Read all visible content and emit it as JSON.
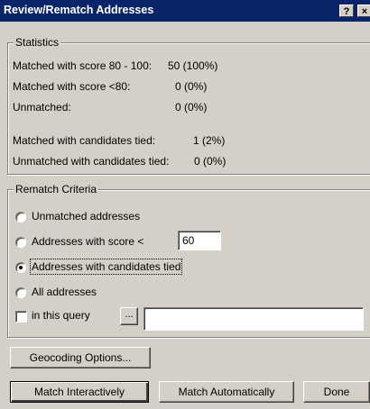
{
  "window": {
    "title": "Review/Rematch Addresses",
    "help_label": "?",
    "close_label": "×"
  },
  "statistics": {
    "legend": "Statistics",
    "rows": [
      {
        "label": "Matched with score 80 - 100:",
        "value": "50  (100%)"
      },
      {
        "label": "Matched with score <80:",
        "value": "0  (0%)"
      },
      {
        "label": "Unmatched:",
        "value": "0  (0%)"
      },
      {
        "label": "Matched with candidates tied:",
        "value": "1  (2%)"
      },
      {
        "label": "Unmatched with candidates tied:",
        "value": "0  (0%)"
      }
    ]
  },
  "rematch": {
    "legend": "Rematch Criteria",
    "options": [
      {
        "label": "Unmatched addresses",
        "checked": false
      },
      {
        "label": "Addresses with score <",
        "checked": false
      },
      {
        "label": "Addresses with candidates tied",
        "checked": true
      },
      {
        "label": "All addresses",
        "checked": false
      }
    ],
    "score_value": "60",
    "query_label": "in this query",
    "query_button": "...",
    "query_value": ""
  },
  "buttons": {
    "geocoding_options": "Geocoding Options...",
    "match_interactively": "Match Interactively",
    "match_automatically": "Match Automatically",
    "done": "Done"
  }
}
